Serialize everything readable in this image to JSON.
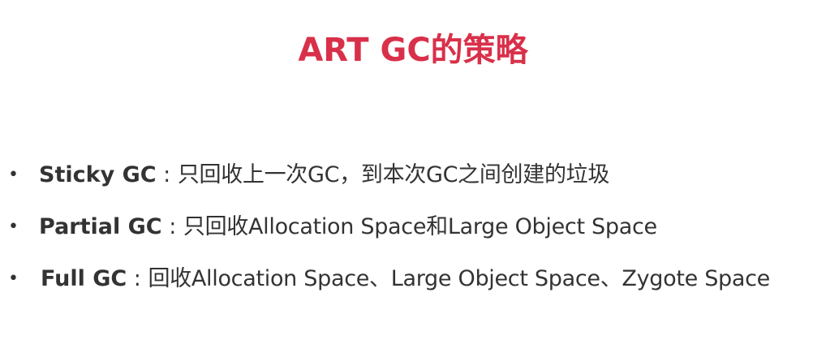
{
  "title": "ART GC的策略",
  "colors": {
    "title": "#d9304a",
    "text": "#333333",
    "background": "#ffffff"
  },
  "bullet_marker": "•",
  "items": [
    {
      "term": "Sticky GC",
      "separator": " : ",
      "description": "只回收上一次GC，到本次GC之间创建的垃圾"
    },
    {
      "term": "Partial GC",
      "separator": " : ",
      "description": "只回收Allocation Space和Large Object Space"
    },
    {
      "term": "Full GC",
      "separator": " :  ",
      "description": "回收Allocation Space、Large Object Space、Zygote Space"
    }
  ]
}
